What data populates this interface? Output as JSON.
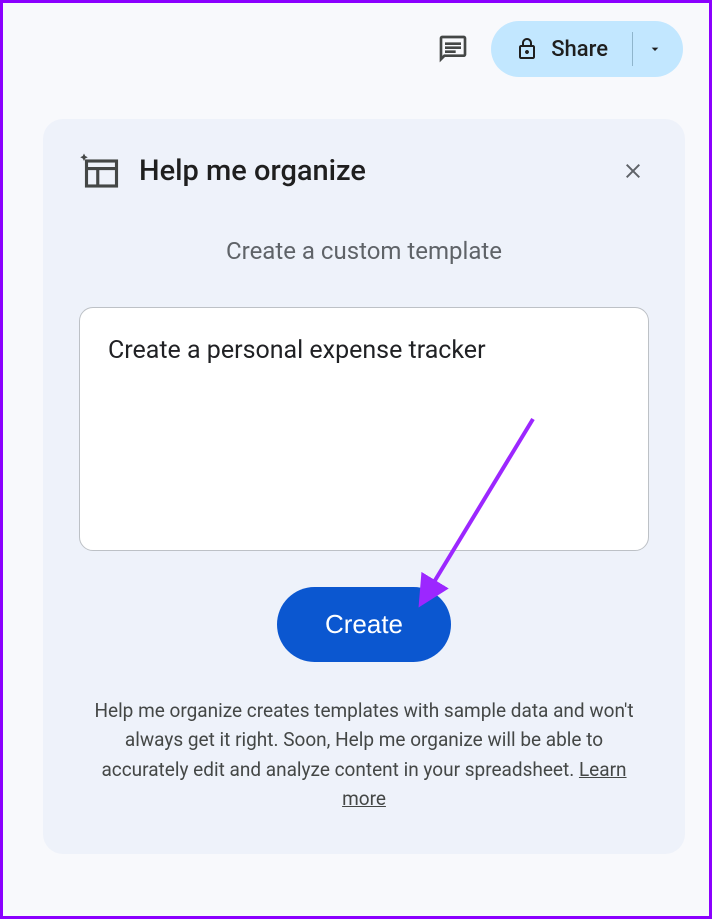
{
  "toolbar": {
    "share_label": "Share"
  },
  "panel": {
    "title": "Help me organize",
    "subtitle": "Create a custom template",
    "prompt_value": "Create a personal expense tracker",
    "create_label": "Create",
    "footer_text": "Help me organize creates templates with sample data and won't always get it right. Soon, Help me organize will be able to accurately edit and analyze content in your spreadsheet. ",
    "learn_more_label": "Learn more"
  }
}
